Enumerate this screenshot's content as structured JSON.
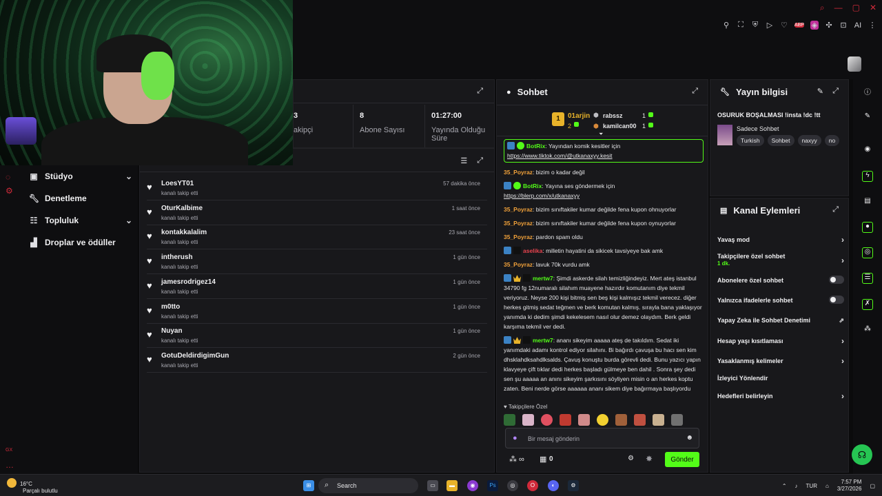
{
  "browser": {
    "ext_ai_label": "AI"
  },
  "sidebar": {
    "items": [
      {
        "label": "Stüdyo",
        "icon": "studio-icon",
        "has_chevron": true
      },
      {
        "label": "Denetleme",
        "icon": "wrench-icon",
        "has_chevron": false
      },
      {
        "label": "Topluluk",
        "icon": "community-icon",
        "has_chevron": true
      },
      {
        "label": "Droplar ve ödüller",
        "icon": "drops-icon",
        "has_chevron": false
      }
    ],
    "rail_text": "GX"
  },
  "stats": {
    "followers_label": "akipçi",
    "followers_value": "3",
    "subs_value": "8",
    "subs_label": "Abone Sayısı",
    "uptime_value": "01:27:00",
    "uptime_label": "Yayında Olduğu Süre"
  },
  "followers": {
    "items": [
      {
        "name": "LoesYT01",
        "sub": "kanalı takip etti",
        "time": "57 dakika önce"
      },
      {
        "name": "OturKalbime",
        "sub": "kanalı takip etti",
        "time": "1 saat önce"
      },
      {
        "name": "kontakkalalim",
        "sub": "kanalı takip etti",
        "time": "23 saat önce"
      },
      {
        "name": "intherush",
        "sub": "kanalı takip etti",
        "time": "1 gün önce"
      },
      {
        "name": "jamesrodrigez14",
        "sub": "kanalı takip etti",
        "time": "1 gün önce"
      },
      {
        "name": "m0tto",
        "sub": "kanalı takip etti",
        "time": "1 gün önce"
      },
      {
        "name": "Nuyan",
        "sub": "kanalı takip etti",
        "time": "1 gün önce"
      },
      {
        "name": "GotuDeldirdigimGun",
        "sub": "kanalı takip etti",
        "time": "2 gün önce"
      }
    ]
  },
  "chat": {
    "title": "Sohbet",
    "leaderboard": {
      "rank": "1",
      "first_name": "01arjin",
      "first_count": "2",
      "second_name": "rabssz",
      "second_count": "1",
      "third_name": "kamilcan00",
      "third_count": "1"
    },
    "messages": {
      "m0_user": "BotRix",
      "m0_text": ": Yayından komik kesitler için",
      "m0_link": "https://www.tiktok.com/@utkanaxyy.kesit",
      "m1_user": "35_Poyraz",
      "m1_text": ": bizim o kadar değil",
      "m2_user": "BotRix",
      "m2_text": ": Yayına ses göndermek için",
      "m2_link": "https://blerp.com/x/utkanaxyy",
      "m3_user": "35_Poyraz",
      "m3_text": ": bizim sınıftakiler kumar değilde fena kupon ohnuyorlar",
      "m4_user": "35_Poyraz",
      "m4_text": ": bizim sınıftakiler kumar değilde fena kupon oynuyorlar",
      "m5_user": "35_Poyraz",
      "m5_text": ": pardon spam oldu",
      "m6_user": "aselika",
      "m6_text": ": milletin hayatini da sikicek tavsiyeye bak amk",
      "m7_user": "35_Poyraz",
      "m7_text": ": lavuk 70k vurdu amk",
      "m8_user": "mertw7",
      "m8_text": ": Şimdi askerde silah temizliğindeyiz. Mert ateş istanbul 34790 fg 12numaralı silahım muayene hazırdır komutanım diye tekmil veriyoruz. Neyse 200 kişi bitmiş sen beş kişi kalmışız tekmil verecez. diğer herkes gitmiş sedat teğmen ve berk komutan kalmış. sırayla bana yaklaşıyor yanımda ki dedim şimdi kekelesem nasıl olur demez olaydım. Berk geldi karşıma tekmil ver dedi.",
      "m9_user": "mertw7",
      "m9_text": ": ananı sikeyim aaaaa ateş de takıldım. Sedat iki yanımdaki adamı kontrol ediyor silahını. Bi bağırdı çavuşa bu hacı sen kim dhsklahdksahdlksalds. Çavuş konuştu burda görevli dedi. Bunu yazıcı yapın klavyeye çift tıklar dedi herkes başladı gülmeye ben dahil . Sonra şey dedi sen şu aaaaa an anını sikeyim şarkısını söyliyen misin o an herkes koptu zaten. Beni nerde görse aaaaaa ananı sikem diye bağırmaya başlıyordu"
    },
    "emote_label": "Takipçilere Özel",
    "input_placeholder": "Bir mesaj gönderin",
    "points": "0",
    "send_label": "Gönder"
  },
  "stream_info": {
    "title": "Yayın bilgisi",
    "stream_title": "OSURUK BOŞALMASI !insta !dc !tt",
    "category": "Sadece Sohbet",
    "tags": [
      "Turkish",
      "Sohbet",
      "naxyy",
      "no"
    ]
  },
  "channel_actions": {
    "title": "Kanal Eylemleri",
    "slow_mode": "Yavaş mod",
    "followers_only": "Takipçilere özel sohbet",
    "followers_only_sub": "1 dk.",
    "subs_only": "Abonelere özel sohbet",
    "emotes_only": "Yalnızca ifadelerle sohbet",
    "ai_moderation": "Yapay Zeka ile Sohbet Denetimi",
    "age_restriction": "Hesap yaşı kısıtlaması",
    "banned_words": "Yasaklanmış kelimeler",
    "viewer_redirect": "İzleyici Yönlendir",
    "goals": "Hedefleri belirleyin"
  },
  "taskbar": {
    "temperature": "16°C",
    "weather": "Parçalı bulutlu",
    "search": "Search",
    "language": "TUR",
    "time": "7:57 PM",
    "date": "3/27/2026"
  },
  "colors": {
    "accent": "#53fc18",
    "brand_red": "#d02a3a",
    "panel_bg": "#18181b",
    "bg": "#0b0b0c",
    "poyraz": "#f2a23a",
    "botrix": "#53fc18",
    "aselika": "#e8434e"
  }
}
